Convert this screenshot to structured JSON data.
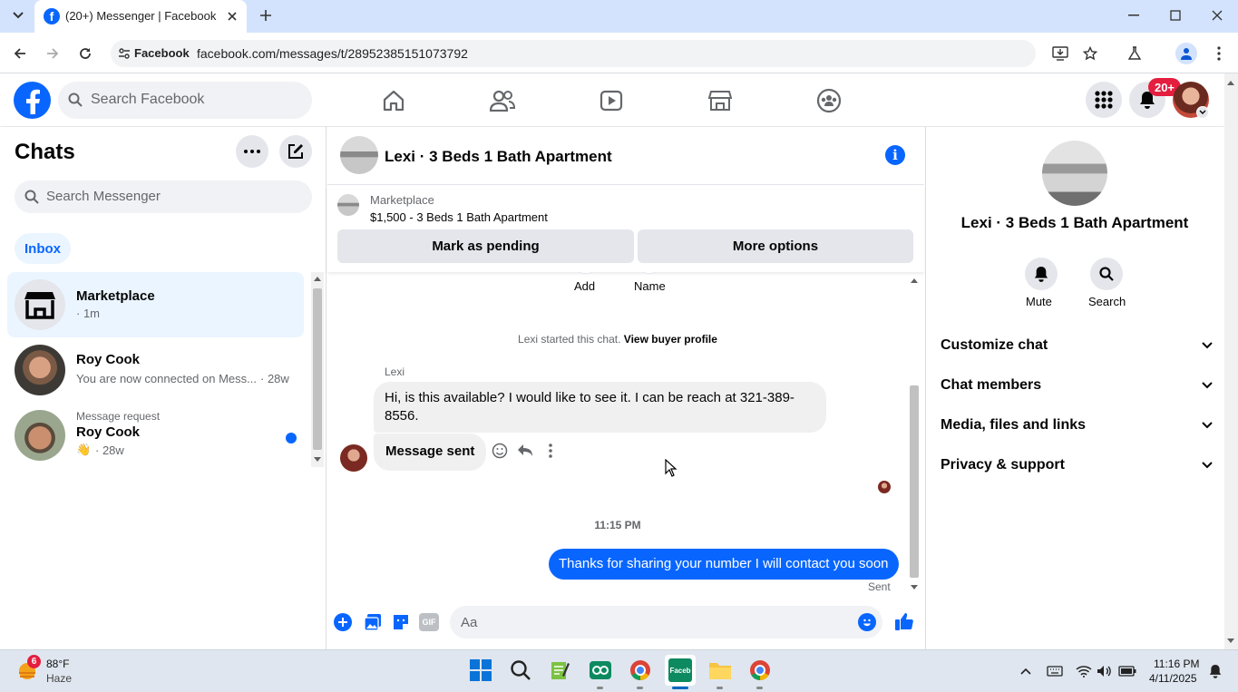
{
  "browser": {
    "tab_title": "(20+) Messenger | Facebook",
    "site_chip": "Facebook",
    "url": "facebook.com/messages/t/28952385151073792"
  },
  "header": {
    "search_placeholder": "Search Facebook",
    "notification_badge": "20+"
  },
  "chats": {
    "title": "Chats",
    "search_placeholder": "Search Messenger",
    "inbox_label": "Inbox",
    "items": [
      {
        "name": "Marketplace",
        "preview": "",
        "time": "· 1m"
      },
      {
        "name": "Roy Cook",
        "preview": "You are now connected on Mess...",
        "time": "· 28w"
      },
      {
        "request_label": "Message request",
        "name": "Roy Cook",
        "preview": "👋",
        "time": "· 28w"
      }
    ]
  },
  "conversation": {
    "title": "Lexi · 3 Beds 1 Bath Apartment",
    "marketplace_label": "Marketplace",
    "listing": "$1,500 - 3 Beds 1 Bath Apartment",
    "mark_pending": "Mark as pending",
    "more_options": "More options",
    "add_label": "Add",
    "name_label": "Name",
    "started_text": "Lexi started this chat.",
    "view_profile": "View buyer profile",
    "sender_name": "Lexi",
    "message1": "Hi, is this available? I would like to see it. I can be reach at 321-389-8556.",
    "message2": "Message sent",
    "timestamp": "11:15 PM",
    "my_message": "Thanks for sharing your number I will contact you soon",
    "sent_status": "Sent",
    "composer_placeholder": "Aa"
  },
  "details": {
    "title": "Lexi · 3 Beds 1 Bath Apartment",
    "mute": "Mute",
    "search": "Search",
    "sections": [
      "Customize chat",
      "Chat members",
      "Media, files and links",
      "Privacy & support"
    ]
  },
  "taskbar": {
    "weather_badge": "6",
    "temp": "88°F",
    "condition": "Haze",
    "time": "11:16 PM",
    "date": "4/11/2025"
  },
  "colors": {
    "fb_blue": "#0866ff",
    "selected_chat": "#ebf5ff",
    "bubble_grey": "#f0f0f0",
    "badge_red": "#e41e3f"
  }
}
